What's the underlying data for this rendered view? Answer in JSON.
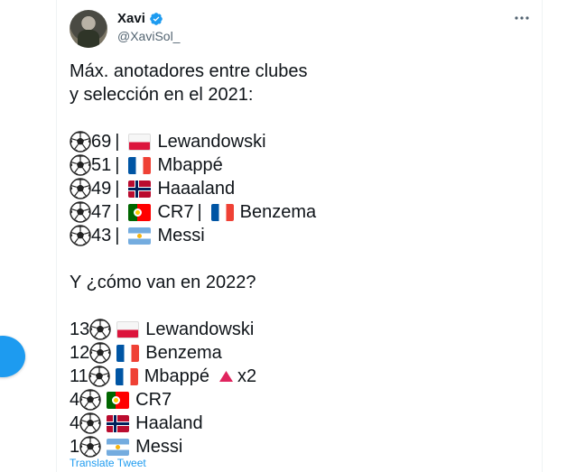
{
  "author": {
    "display_name": "Xavi",
    "handle": "@XaviSol_"
  },
  "tweet": {
    "intro_line1": "Máx. anotadores entre clubes",
    "intro_line2": "y selección en el 2021:",
    "rank_2021": [
      {
        "goals": "69",
        "flag": "poland",
        "player": "Lewandowski"
      },
      {
        "goals": "51",
        "flag": "france",
        "player": "Mbappé"
      },
      {
        "goals": "49",
        "flag": "norway",
        "player": "Haaaland"
      },
      {
        "goals": "47",
        "flag": "portugal",
        "player": "CR7",
        "flag2": "france",
        "player2": "Benzema"
      },
      {
        "goals": "43",
        "flag": "argentina",
        "player": "Messi"
      }
    ],
    "question": "Y ¿cómo van en 2022?",
    "rank_2022": [
      {
        "goals": "13",
        "flag": "poland",
        "player": "Lewandowski"
      },
      {
        "goals": "12",
        "flag": "france",
        "player": "Benzema"
      },
      {
        "goals": "11",
        "flag": "france",
        "player": "Mbappé",
        "extra": "x2"
      },
      {
        "goals": "4",
        "flag": "portugal",
        "player": "CR7"
      },
      {
        "goals": "4",
        "flag": "norway",
        "player": "Haaland"
      },
      {
        "goals": "1",
        "flag": "argentina",
        "player": "Messi"
      }
    ],
    "separator": "|",
    "translate_label": "Translate Tweet"
  },
  "colors": {
    "accent": "#1d9bf0",
    "text": "#0f1419",
    "muted": "#536471",
    "up_triangle": "#e0245e"
  },
  "icons": {
    "verified": "verified-badge-icon",
    "more": "more-options-icon",
    "ball": "soccer-ball-icon",
    "triangle": "up-triangle-icon"
  }
}
